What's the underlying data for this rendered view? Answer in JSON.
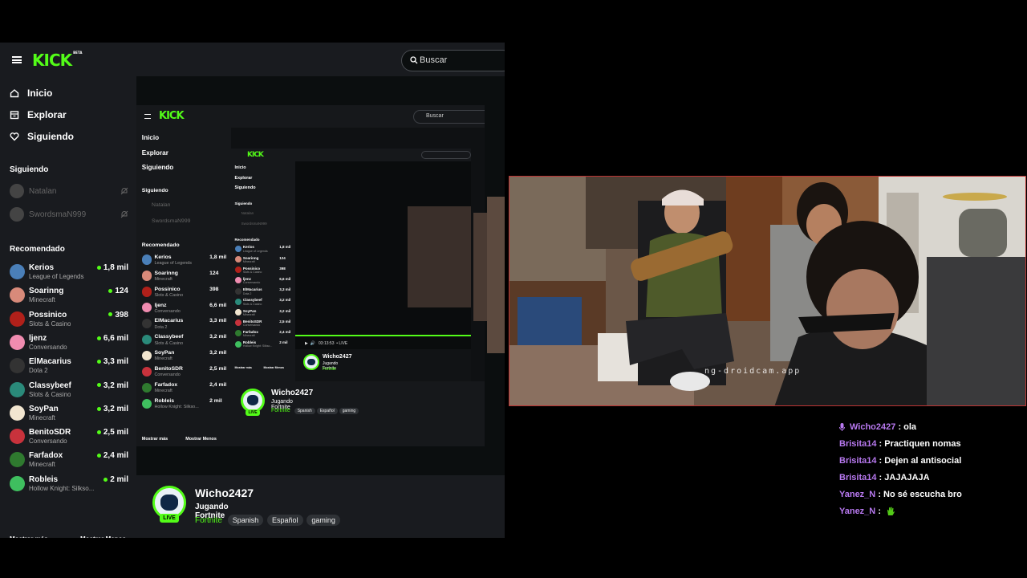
{
  "kick": {
    "logo": "KICK",
    "beta": "BETA",
    "search_placeholder": "Buscar",
    "nav": {
      "home": "Inicio",
      "explore": "Explorar",
      "following": "Siguiendo"
    },
    "following_title": "Siguiendo",
    "following": [
      {
        "name": "Natalan"
      },
      {
        "name": "SwordsmaN999"
      }
    ],
    "recommended_title": "Recomendado",
    "recommended": [
      {
        "name": "Kerios",
        "category": "League of Legends",
        "viewers": "1,8 mil",
        "avatar_color": "#4a7fb8"
      },
      {
        "name": "Soarinng",
        "category": "Minecraft",
        "viewers": "124",
        "avatar_color": "#d88a7a"
      },
      {
        "name": "Possinico",
        "category": "Slots & Casino",
        "viewers": "398",
        "avatar_color": "#b0201a"
      },
      {
        "name": "ljenz",
        "category": "Conversando",
        "viewers": "6,6 mil",
        "avatar_color": "#f08cb0"
      },
      {
        "name": "ElMacarius",
        "category": "Dota 2",
        "viewers": "3,3 mil",
        "avatar_color": "#333333"
      },
      {
        "name": "Classybeef",
        "category": "Slots & Casino",
        "viewers": "3,2 mil",
        "avatar_color": "#2a8a7a"
      },
      {
        "name": "SoyPan",
        "category": "Minecraft",
        "viewers": "3,2 mil",
        "avatar_color": "#f2e6d0"
      },
      {
        "name": "BenitoSDR",
        "category": "Conversando",
        "viewers": "2,5 mil",
        "avatar_color": "#c8323c"
      },
      {
        "name": "Farfadox",
        "category": "Minecraft",
        "viewers": "2,4 mil",
        "avatar_color": "#2f7a2f"
      },
      {
        "name": "Robleis",
        "category": "Hollow Knight: Silkso...",
        "viewers": "2 mil",
        "avatar_color": "#3fbf5f"
      }
    ],
    "show_more": "Mostrar más",
    "show_less": "Mostrar Menos",
    "stream": {
      "channel": "Wicho2427",
      "title": "Jugando Fortnite",
      "category": "Fortnite",
      "tags": [
        "Spanish",
        "Español",
        "gaming"
      ],
      "live": "LIVE"
    },
    "player_time": "03:13:53",
    "player_live": "LIVE"
  },
  "webcam": {
    "watermark": "ng-droidcam.app"
  },
  "chat": [
    {
      "user": "Wicho2427",
      "text": ": ola",
      "badge": "mic"
    },
    {
      "user": "Brisita14",
      "text": ": Practiquen nomas"
    },
    {
      "user": "Brisita14",
      "text": ": Dejen al antisocial"
    },
    {
      "user": "Brisita14",
      "text": ": JAJAJAJA"
    },
    {
      "user": "Yanez_N",
      "text": ": No sé escucha bro"
    },
    {
      "user": "Yanez_N",
      "text": ":",
      "emote": "green-hand-emote"
    }
  ],
  "colors": {
    "kick_green": "#53fc18",
    "chat_user": "#b879f0",
    "sidebar_bg": "#191b1f"
  }
}
